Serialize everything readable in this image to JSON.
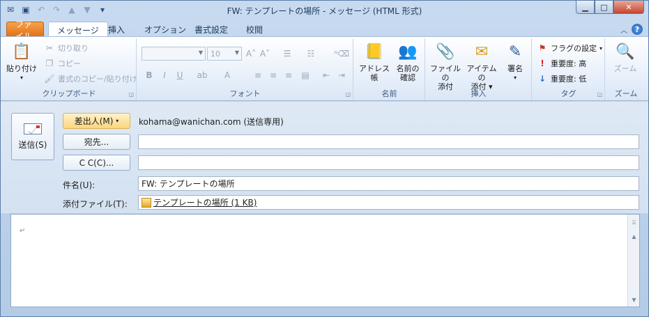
{
  "window": {
    "title": "FW: テンプレートの場所 - メッセージ (HTML 形式)"
  },
  "quick_access": {
    "icons": [
      "app-icon",
      "save-icon",
      "undo-icon",
      "redo-icon",
      "up-icon",
      "down-icon",
      "customize-icon"
    ]
  },
  "tabs": [
    {
      "label": "ファイル"
    },
    {
      "label": "メッセージ"
    },
    {
      "label": "挿入"
    },
    {
      "label": "オプション"
    },
    {
      "label": "書式設定"
    },
    {
      "label": "校閲"
    }
  ],
  "ribbon": {
    "clipboard": {
      "group_label": "クリップボード",
      "paste": "貼り付け",
      "cut": "切り取り",
      "copy": "コピー",
      "format_painter": "書式のコピー/貼り付け"
    },
    "font": {
      "group_label": "フォント",
      "font_name": "",
      "font_size": "10"
    },
    "names": {
      "group_label": "名前",
      "address_book": "アドレス帳",
      "check_names_1": "名前の",
      "check_names_2": "確認"
    },
    "insert": {
      "group_label": "挿入",
      "attach_file_1": "ファイルの",
      "attach_file_2": "添付",
      "attach_item_1": "アイテムの",
      "attach_item_2": "添付",
      "signature": "署名"
    },
    "tags": {
      "group_label": "タグ",
      "follow_up": "フラグの設定",
      "high_importance": "重要度: 高",
      "low_importance": "重要度: 低"
    },
    "zoom": {
      "group_label": "ズーム",
      "zoom": "ズーム"
    }
  },
  "compose": {
    "send_label": "送信(S)",
    "from_button": "差出人(M)",
    "from_value": "kohama@wanichan.com (送信専用)",
    "to_button": "宛先...",
    "to_value": "",
    "cc_button": "C C(C)...",
    "cc_value": "",
    "subject_label": "件名(U):",
    "subject_value": "FW: テンプレートの場所",
    "attach_label": "添付ファイル(T):",
    "attachment": "テンプレートの場所 (1 KB)"
  },
  "body": {
    "text": "↵"
  }
}
